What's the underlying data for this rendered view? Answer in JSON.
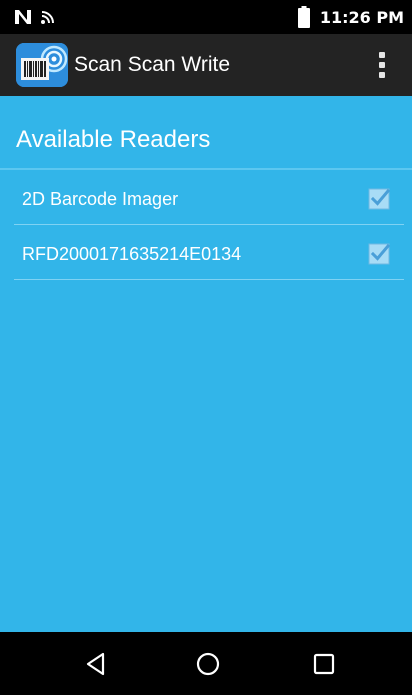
{
  "status_bar": {
    "time": "11:26 PM",
    "icons": [
      "nfc-icon",
      "wifi-icon",
      "battery-icon"
    ]
  },
  "app_bar": {
    "title": "Scan Scan Write",
    "icon": "barcode-scanner-app-icon",
    "overflow_icon": "more-vert-icon"
  },
  "readers": {
    "title": "Available Readers",
    "items": [
      {
        "label": "2D Barcode Imager",
        "checked": true
      },
      {
        "label": "RFD2000171635214E0134",
        "checked": true
      }
    ]
  },
  "nav_bar": {
    "buttons": [
      "back-icon",
      "home-icon",
      "recents-icon"
    ]
  },
  "colors": {
    "status_bar": "#000000",
    "app_bar": "#232323",
    "content_background": "#32b5e9",
    "checkbox": "#5ab4e6"
  }
}
